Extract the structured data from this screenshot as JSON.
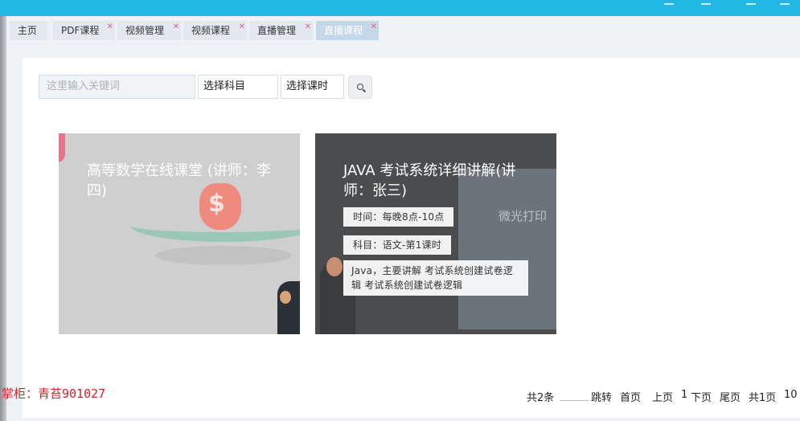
{
  "colors": {
    "topbar": "#23b7e5",
    "active_tab": "#c5d8ea",
    "shop_label": "#e0202a"
  },
  "tabs": [
    {
      "label": "主页",
      "closable": false,
      "active": false
    },
    {
      "label": "PDF课程",
      "closable": true,
      "active": false
    },
    {
      "label": "视频管理",
      "closable": true,
      "active": false
    },
    {
      "label": "视频课程",
      "closable": true,
      "active": false
    },
    {
      "label": "直播管理",
      "closable": true,
      "active": false
    },
    {
      "label": "直播课程",
      "closable": true,
      "active": true
    }
  ],
  "search": {
    "placeholder": "这里输入关键词",
    "subject_select": "选择科目",
    "period_select": "选择课时",
    "button_icon": "search-icon"
  },
  "courses": [
    {
      "title": "高等数学在线课堂 (讲师：李四)"
    },
    {
      "title": "JAVA 考试系统详细讲解(讲师：张三)",
      "time": "时间：每晚8点-10点",
      "subject": "科目：语文-第1课时",
      "description": "Java，主要讲解 考试系统创建试卷逻辑 考试系统创建试卷逻辑",
      "screen_text": "微光打印"
    }
  ],
  "shop_label": "掌柜：青苔901027",
  "pagination": {
    "total": "共2条",
    "jump": "跳转",
    "first": "首页",
    "prev": "上页",
    "current": "1",
    "next": "下页",
    "last": "尾页",
    "pages": "共1页",
    "page_size": "10"
  }
}
